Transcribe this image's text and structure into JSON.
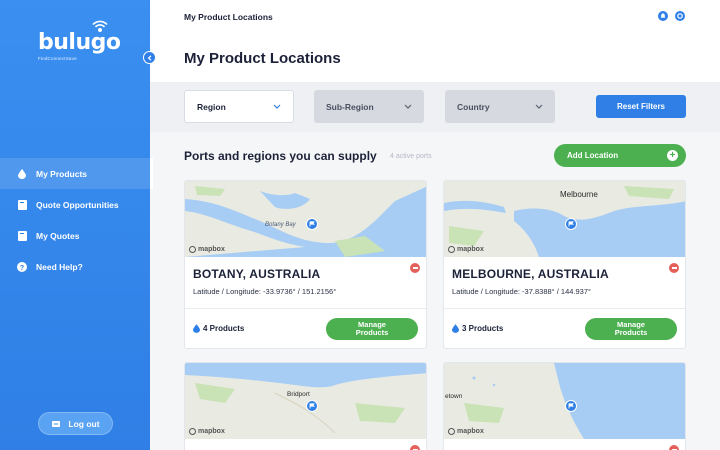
{
  "brand": {
    "name": "bulugo",
    "tagline": "FindConnectSave"
  },
  "sidebar": {
    "items": [
      {
        "label": "My Products",
        "icon": "drop-icon",
        "active": true
      },
      {
        "label": "Quote Opportunities",
        "icon": "book-icon",
        "active": false
      },
      {
        "label": "My Quotes",
        "icon": "book-icon",
        "active": false
      },
      {
        "label": "Need Help?",
        "icon": "help-icon",
        "active": false
      }
    ],
    "logout_label": "Log out"
  },
  "topbar": {
    "title": "My Product Locations"
  },
  "page": {
    "title": "My Product Locations"
  },
  "filters": {
    "region": "Region",
    "subregion": "Sub-Region",
    "country": "Country",
    "reset_label": "Reset Filters"
  },
  "section": {
    "title": "Ports and regions you can supply",
    "subtitle": "4 active ports",
    "add_label": "Add Location"
  },
  "cards": [
    {
      "title": "BOTANY, AUSTRALIA",
      "coords": "Latitude / Longitude: -33.9736° / 151.2156°",
      "products": "4 Products",
      "manage_label": "Manage Products",
      "map_label": "Botany Bay",
      "attribution": "mapbox"
    },
    {
      "title": "MELBOURNE, AUSTRALIA",
      "coords": "Latitude / Longitude: -37.8388° / 144.937°",
      "products": "3 Products",
      "manage_label": "Manage Products",
      "map_label": "Melbourne",
      "attribution": "mapbox"
    },
    {
      "map_label": "Bridport",
      "attribution": "mapbox"
    },
    {
      "map_label": "etown",
      "attribution": "mapbox"
    }
  ],
  "colors": {
    "primary": "#2f7fe6",
    "success": "#4caf50",
    "danger": "#e36159",
    "water": "#a7cdf5",
    "land": "#e9eae1"
  }
}
